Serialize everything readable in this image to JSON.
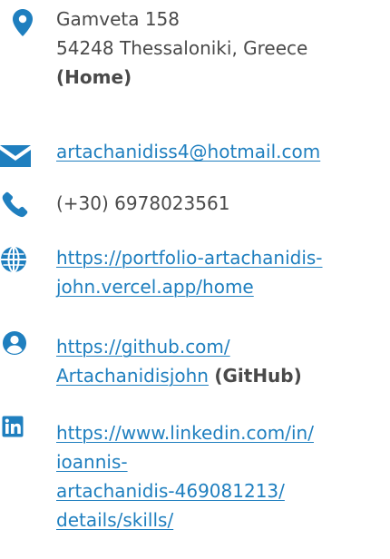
{
  "colors": {
    "icon": "#1f7fbf",
    "link": "#1f7fbf",
    "text": "#4a4a4a",
    "background": "#ffffff"
  },
  "address": {
    "icon": "map-marker-icon",
    "line1": "Gamveta 158",
    "line2": "54248 Thessaloniki, Greece",
    "label": "(Home)"
  },
  "email": {
    "icon": "envelope-icon",
    "text": "artachanidiss4@hotmail.com"
  },
  "phone": {
    "icon": "phone-icon",
    "text": "(+30) 6978023561"
  },
  "website": {
    "icon": "globe-icon",
    "line1": "https://portfolio-artachanidis-",
    "line2": "john.vercel.app/home"
  },
  "github": {
    "icon": "user-circle-icon",
    "line1": "https://github.com/",
    "line2": "Artachanidisjohn",
    "label": "(GitHub)"
  },
  "linkedin": {
    "icon": "linkedin-icon",
    "line1": "https://www.linkedin.com/in/",
    "line2": "ioannis-",
    "line3": "artachanidis-469081213/",
    "line4": "details/skills/"
  }
}
